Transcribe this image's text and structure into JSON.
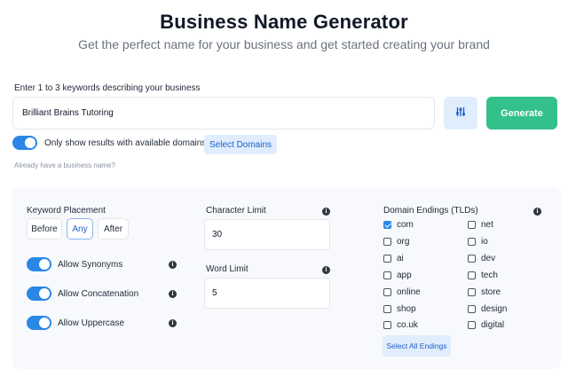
{
  "header": {
    "title": "Business Name Generator",
    "subtitle": "Get the perfect name for your business and get started creating your brand"
  },
  "search": {
    "label": "Enter 1 to 3 keywords describing your business",
    "value": "Brilliant Brains Tutoring",
    "generate_label": "Generate",
    "filter_icon": "sliders-icon"
  },
  "availability": {
    "toggle_on": true,
    "label": "Only show results with available domains",
    "select_domains_label": "Select Domains",
    "already_link": "Already have a business name?"
  },
  "options": {
    "keyword_placement": {
      "label": "Keyword Placement",
      "buttons": [
        "Before",
        "Any",
        "After"
      ],
      "selected": "Any"
    },
    "toggles": [
      {
        "label": "Allow Synonyms",
        "on": true
      },
      {
        "label": "Allow Concatenation",
        "on": true
      },
      {
        "label": "Allow Uppercase",
        "on": true
      }
    ],
    "character_limit": {
      "label": "Character Limit",
      "value": "30"
    },
    "word_limit": {
      "label": "Word Limit",
      "value": "5"
    },
    "domain_endings": {
      "label": "Domain Endings (TLDs)",
      "left": [
        {
          "tld": "com",
          "checked": true
        },
        {
          "tld": "org",
          "checked": false
        },
        {
          "tld": "ai",
          "checked": false
        },
        {
          "tld": "app",
          "checked": false
        },
        {
          "tld": "online",
          "checked": false
        },
        {
          "tld": "shop",
          "checked": false
        },
        {
          "tld": "co.uk",
          "checked": false
        }
      ],
      "right": [
        {
          "tld": "net",
          "checked": false
        },
        {
          "tld": "io",
          "checked": false
        },
        {
          "tld": "dev",
          "checked": false
        },
        {
          "tld": "tech",
          "checked": false
        },
        {
          "tld": "store",
          "checked": false
        },
        {
          "tld": "design",
          "checked": false
        },
        {
          "tld": "digital",
          "checked": false
        }
      ],
      "select_all_label": "Select All Endings"
    }
  },
  "colors": {
    "accent": "#2b87e6",
    "generate": "#34c08a",
    "soft_blue": "#e0edfd",
    "panel": "#f7f9fc"
  }
}
